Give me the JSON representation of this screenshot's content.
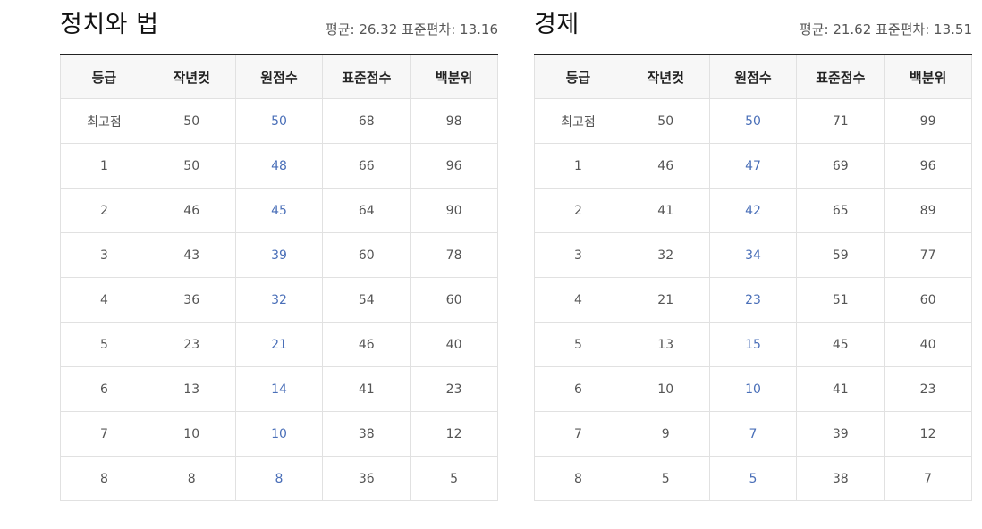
{
  "columns": [
    "등급",
    "작년컷",
    "원점수",
    "표준점수",
    "백분위"
  ],
  "panels": [
    {
      "title": "정치와 법",
      "stats": "평균: 26.32 표준편차: 13.16",
      "rows": [
        [
          "최고점",
          "50",
          "50",
          "68",
          "98"
        ],
        [
          "1",
          "50",
          "48",
          "66",
          "96"
        ],
        [
          "2",
          "46",
          "45",
          "64",
          "90"
        ],
        [
          "3",
          "43",
          "39",
          "60",
          "78"
        ],
        [
          "4",
          "36",
          "32",
          "54",
          "60"
        ],
        [
          "5",
          "23",
          "21",
          "46",
          "40"
        ],
        [
          "6",
          "13",
          "14",
          "41",
          "23"
        ],
        [
          "7",
          "10",
          "10",
          "38",
          "12"
        ],
        [
          "8",
          "8",
          "8",
          "36",
          "5"
        ]
      ]
    },
    {
      "title": "경제",
      "stats": "평균: 21.62 표준편차: 13.51",
      "rows": [
        [
          "최고점",
          "50",
          "50",
          "71",
          "99"
        ],
        [
          "1",
          "46",
          "47",
          "69",
          "96"
        ],
        [
          "2",
          "41",
          "42",
          "65",
          "89"
        ],
        [
          "3",
          "32",
          "34",
          "59",
          "77"
        ],
        [
          "4",
          "21",
          "23",
          "51",
          "60"
        ],
        [
          "5",
          "13",
          "15",
          "45",
          "40"
        ],
        [
          "6",
          "10",
          "10",
          "41",
          "23"
        ],
        [
          "7",
          "9",
          "7",
          "39",
          "12"
        ],
        [
          "8",
          "5",
          "5",
          "38",
          "7"
        ]
      ]
    }
  ],
  "colors": {
    "raw_score_text": "#4a6fb8",
    "header_bg": "#f7f7f7",
    "border": "#e1e1e1",
    "top_rule": "#222222"
  }
}
